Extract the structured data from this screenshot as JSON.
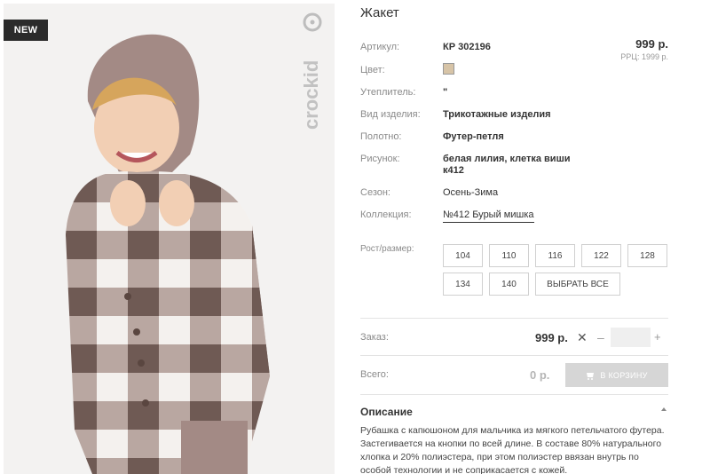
{
  "badge": "NEW",
  "brand": "crockid",
  "product": {
    "title": "Жакет",
    "price": "999 р.",
    "rrc": "РРЦ: 1999 р.",
    "color_swatch": "#d7c4a7"
  },
  "attributes": [
    {
      "label": "Артикул:",
      "value": "КР 302196"
    },
    {
      "label": "Цвет:",
      "value": ""
    },
    {
      "label": "Утеплитель:",
      "value": "\""
    },
    {
      "label": "Вид изделия:",
      "value": "Трикотажные изделия"
    },
    {
      "label": "Полотно:",
      "value": "Футер-петля"
    },
    {
      "label": "Рисунок:",
      "value": "белая лилия, клетка виши к412"
    },
    {
      "label": "Сезон:",
      "value": "Осень-Зима"
    },
    {
      "label": "Коллекция:",
      "value": "№412 Бурый мишка"
    }
  ],
  "sizes": {
    "label": "Рост/размер:",
    "options": [
      "104",
      "110",
      "116",
      "122",
      "128",
      "134",
      "140"
    ],
    "select_all": "ВЫБРАТЬ ВСЕ"
  },
  "order": {
    "label": "Заказ:",
    "price": "999 р.",
    "multiply": "✕",
    "minus": "–",
    "plus": "+",
    "quantity": ""
  },
  "total": {
    "label": "Всего:",
    "value": "0 р.",
    "cart_button": "В КОРЗИНУ"
  },
  "description": {
    "title": "Описание",
    "text": "Рубашка с капюшоном для мальчика из мягкого петельчатого футера. Застегивается на кнопки по всей длине. В составе 80% натурального хлопка и 20% полиэстера, при этом полиэстер ввязан внутрь по особой технологии и не соприкасается с кожей."
  }
}
